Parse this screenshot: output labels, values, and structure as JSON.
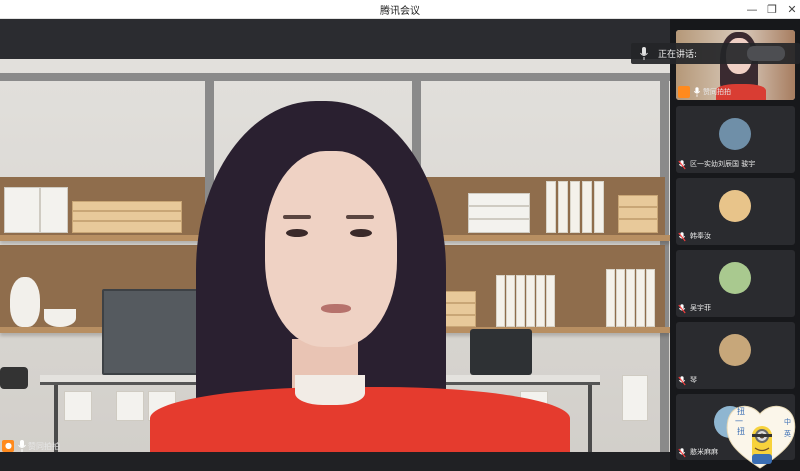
{
  "window": {
    "title": "腾讯会议",
    "controls": {
      "minimize": "—",
      "maximize": "❐",
      "close": "✕"
    }
  },
  "main_video": {
    "speaker_name": "赞同拍拍"
  },
  "speaking_indicator": {
    "label": "正在讲话:"
  },
  "participants": [
    {
      "name": "赞同拍拍",
      "host": true
    },
    {
      "name": "区一实幼刘辰国 骏宇"
    },
    {
      "name": "韩奉汝"
    },
    {
      "name": "吴宇菲"
    },
    {
      "name": "琴"
    },
    {
      "name": "憨米麻麻"
    }
  ],
  "sticker_text": [
    "扭",
    "一",
    "扭",
    "中",
    "英"
  ],
  "colors": {
    "accent_orange": "#ff8a1e",
    "shirt_red": "#e53b2e",
    "background_dark": "#1f2023"
  }
}
